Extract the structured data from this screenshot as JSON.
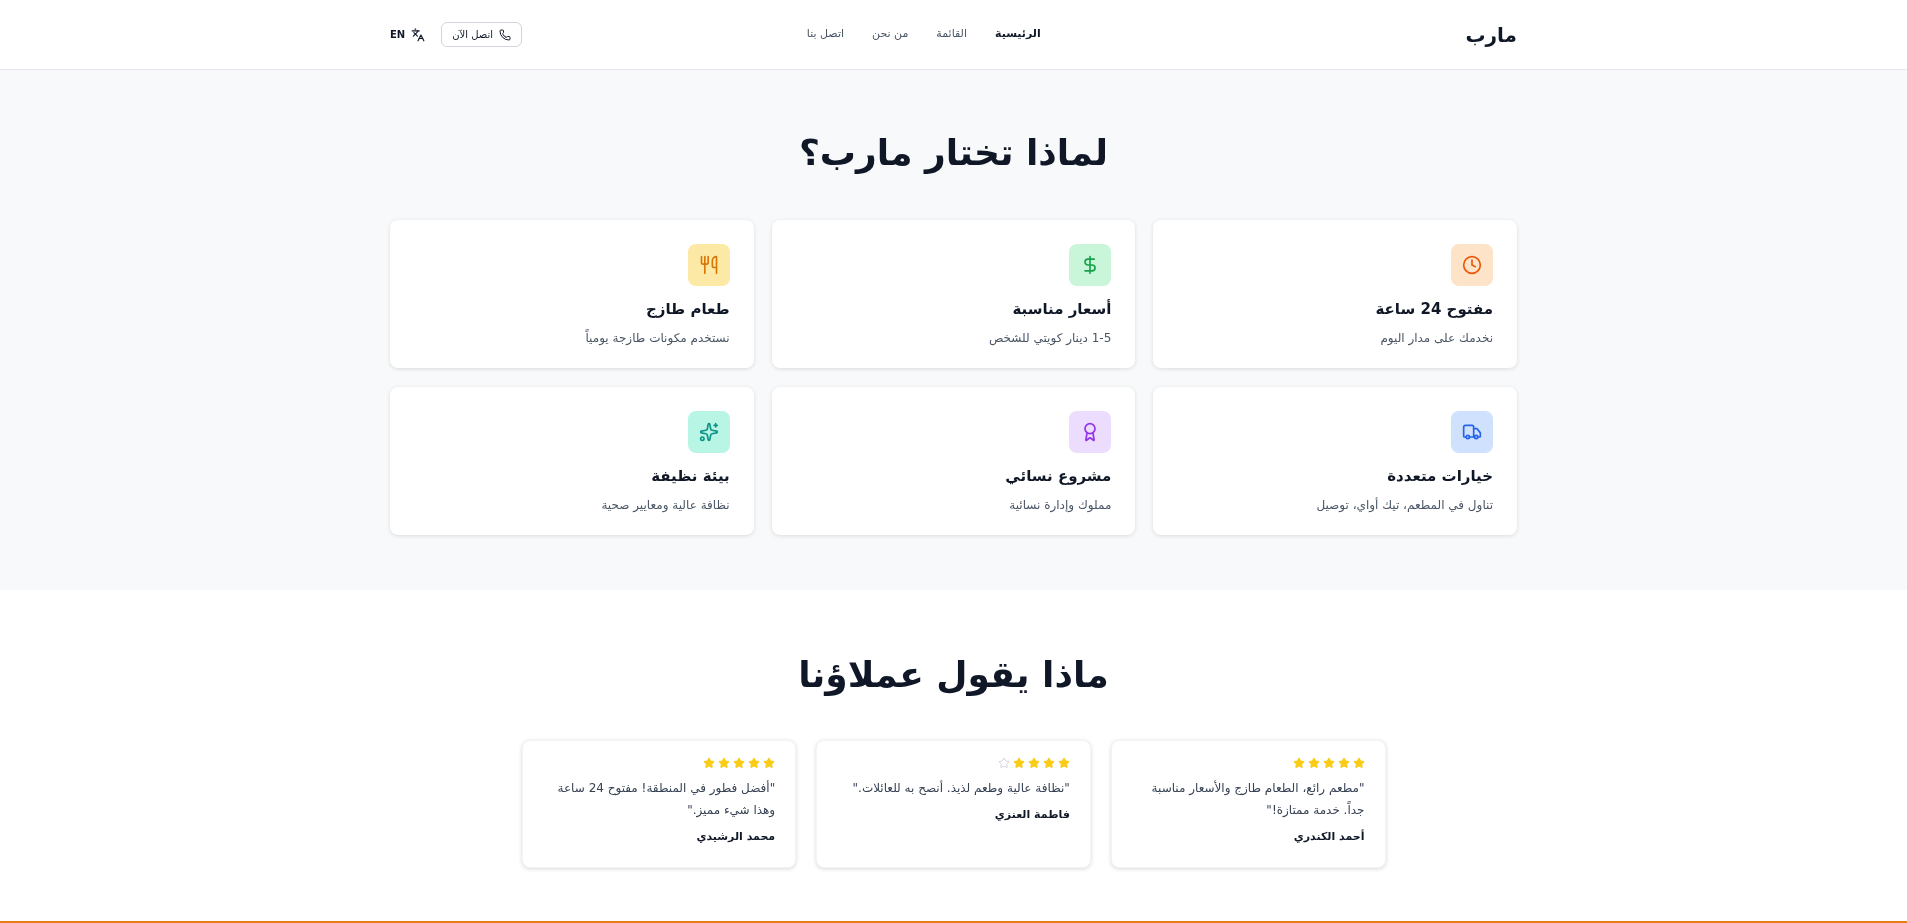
{
  "header": {
    "logo": "مارب",
    "nav": [
      {
        "label": "الرئيسية",
        "selected": true
      },
      {
        "label": "القائمة",
        "selected": false
      },
      {
        "label": "من نحن",
        "selected": false
      },
      {
        "label": "اتصل بنا",
        "selected": false
      }
    ],
    "call_button": "اتصل الآن",
    "language": "EN"
  },
  "features": {
    "title": "لماذا تختار مارب؟",
    "items": [
      {
        "kind": "clock",
        "title": "مفتوح 24 ساعة",
        "text": "نخدمك على مدار اليوم"
      },
      {
        "kind": "dollar",
        "title": "أسعار مناسبة",
        "text": "1-5 دينار كويتي للشخص"
      },
      {
        "kind": "utensils",
        "title": "طعام طازج",
        "text": "نستخدم مكونات طازجة يومياً"
      },
      {
        "kind": "truck",
        "title": "خيارات متعددة",
        "text": "تناول في المطعم، تيك أواي، توصيل"
      },
      {
        "kind": "award",
        "title": "مشروع نسائي",
        "text": "مملوك وإدارة نسائية"
      },
      {
        "kind": "sparkles",
        "title": "بيئة نظيفة",
        "text": "نظافة عالية ومعايير صحية"
      }
    ]
  },
  "testimonials": {
    "title": "ماذا يقول عملاؤنا",
    "items": [
      {
        "stars": 5,
        "quote": "\"مطعم رائع، الطعام طازج والأسعار مناسبة جداً. خدمة ممتازة!\"",
        "name": "أحمد الكندري"
      },
      {
        "stars": 4,
        "quote": "\"نظافة عالية وطعم لذيذ. أنصح به للعائلات.\"",
        "name": "فاطمة العنزي"
      },
      {
        "stars": 5,
        "quote": "\"أفضل فطور في المنطقة! مفتوح 24 ساعة وهذا شيء مميز.\"",
        "name": "محمد الرشيدي"
      }
    ]
  }
}
